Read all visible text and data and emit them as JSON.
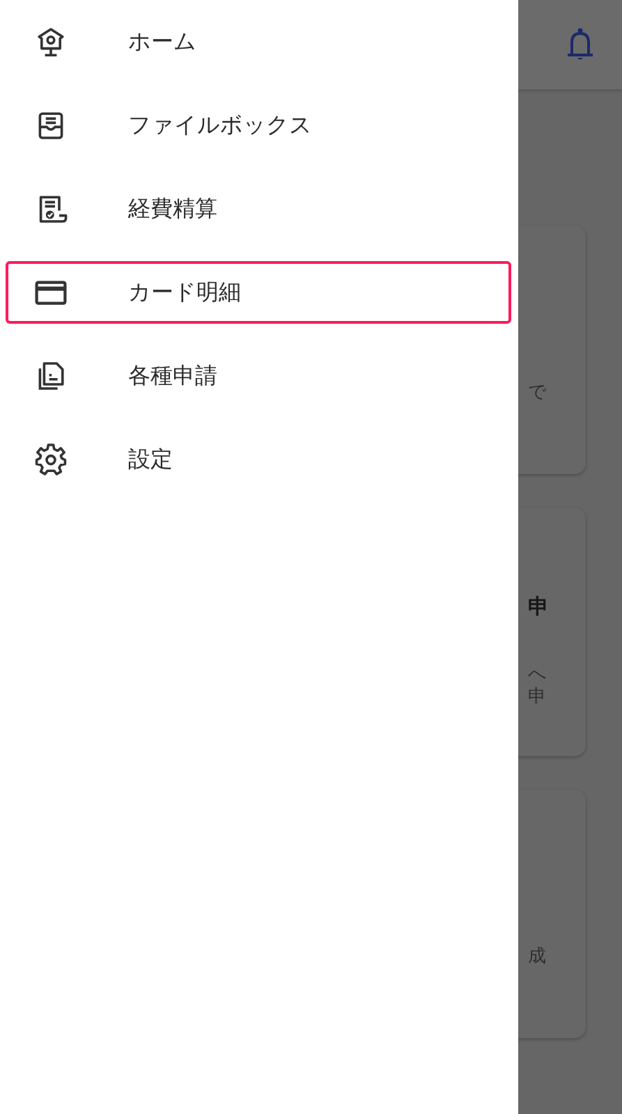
{
  "drawer": {
    "items": [
      {
        "label": "ホーム",
        "kind": "home",
        "selected": false
      },
      {
        "label": "ファイルボックス",
        "kind": "inbox",
        "selected": false
      },
      {
        "label": "経費精算",
        "kind": "receipt",
        "selected": false
      },
      {
        "label": "カード明細",
        "kind": "card",
        "selected": true
      },
      {
        "label": "各種申請",
        "kind": "documents",
        "selected": false
      },
      {
        "label": "設定",
        "kind": "settings",
        "selected": false
      }
    ]
  },
  "background": {
    "cards": [
      {
        "lines": [
          "で"
        ]
      },
      {
        "title": "申",
        "lines": [
          "へ",
          "申"
        ]
      },
      {
        "lines": [
          "成"
        ]
      }
    ]
  }
}
